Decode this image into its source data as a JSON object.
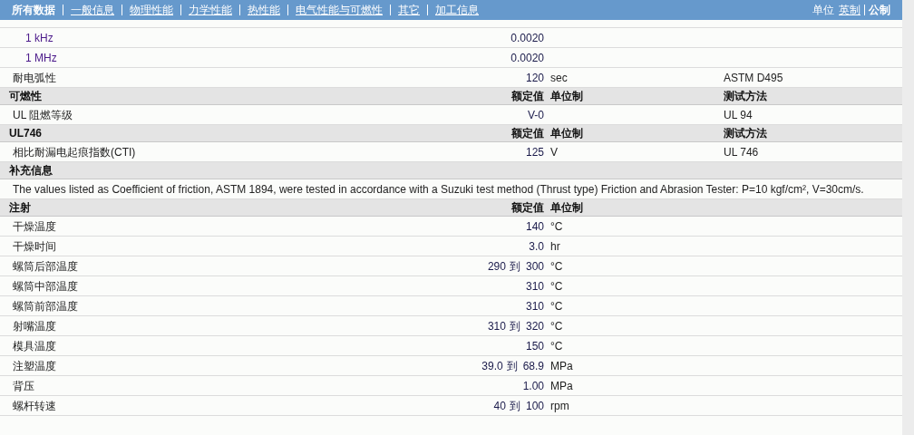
{
  "nav": {
    "tabs": [
      {
        "label": "所有数据",
        "selected": true
      },
      {
        "label": "一般信息",
        "selected": false
      },
      {
        "label": "物理性能",
        "selected": false
      },
      {
        "label": "力学性能",
        "selected": false
      },
      {
        "label": "热性能",
        "selected": false
      },
      {
        "label": "电气性能与可燃性",
        "selected": false
      },
      {
        "label": "其它",
        "selected": false
      },
      {
        "label": "加工信息",
        "selected": false
      }
    ],
    "units": {
      "label": "单位",
      "options": [
        {
          "label": "英制",
          "selected": false
        },
        {
          "label": "公制",
          "selected": true
        }
      ]
    }
  },
  "sections": [
    {
      "kind": "table",
      "rows": [
        {
          "kind": "sub",
          "name": "1 kHz",
          "value": "0.0020"
        },
        {
          "kind": "sub",
          "name": "1 MHz",
          "value": "0.0020"
        },
        {
          "kind": "main",
          "name": "耐电弧性",
          "value": "120",
          "unit": "sec",
          "method": "ASTM D495"
        }
      ]
    },
    {
      "kind": "table",
      "title": "可燃性",
      "columns": {
        "value": "额定值",
        "unit": "单位制",
        "method": "测试方法"
      },
      "rows": [
        {
          "kind": "main",
          "name": "UL 阻燃等级",
          "value": "V-0",
          "method": "UL 94"
        }
      ]
    },
    {
      "kind": "table",
      "title": "UL746",
      "columns": {
        "value": "额定值",
        "unit": "单位制",
        "method": "测试方法"
      },
      "rows": [
        {
          "kind": "main",
          "name": "相比耐漏电起痕指数(CTI)",
          "value": "125",
          "unit": "V",
          "method": "UL 746"
        }
      ]
    },
    {
      "kind": "note",
      "title": "补充信息",
      "text": "The values listed as Coefficient of friction, ASTM 1894, were tested in accordance with a Suzuki test method (Thrust type) Friction and Abrasion Tester: P=10 kgf/cm², V=30cm/s."
    },
    {
      "kind": "table",
      "title": "注射",
      "columns": {
        "value": "额定值",
        "unit": "单位制"
      },
      "rows": [
        {
          "kind": "main",
          "name": "干燥温度",
          "value": "140",
          "unit": "°C"
        },
        {
          "kind": "main",
          "name": "干燥时间",
          "value": "3.0",
          "unit": "hr"
        },
        {
          "kind": "main",
          "name": "螺筒后部温度",
          "low": "290",
          "range_word": "到",
          "value": "300",
          "unit": "°C"
        },
        {
          "kind": "main",
          "name": "螺筒中部温度",
          "value": "310",
          "unit": "°C"
        },
        {
          "kind": "main",
          "name": "螺筒前部温度",
          "value": "310",
          "unit": "°C"
        },
        {
          "kind": "main",
          "name": "射嘴温度",
          "low": "310",
          "range_word": "到",
          "value": "320",
          "unit": "°C"
        },
        {
          "kind": "main",
          "name": "模具温度",
          "value": "150",
          "unit": "°C"
        },
        {
          "kind": "main",
          "name": "注塑温度",
          "low": "39.0",
          "range_word": "到",
          "value": "68.9",
          "unit": "MPa"
        },
        {
          "kind": "main",
          "name": "背压",
          "value": "1.00",
          "unit": "MPa"
        },
        {
          "kind": "main",
          "name": "螺杆转速",
          "low": "40",
          "range_word": "到",
          "value": "100",
          "unit": "rpm"
        }
      ]
    }
  ]
}
